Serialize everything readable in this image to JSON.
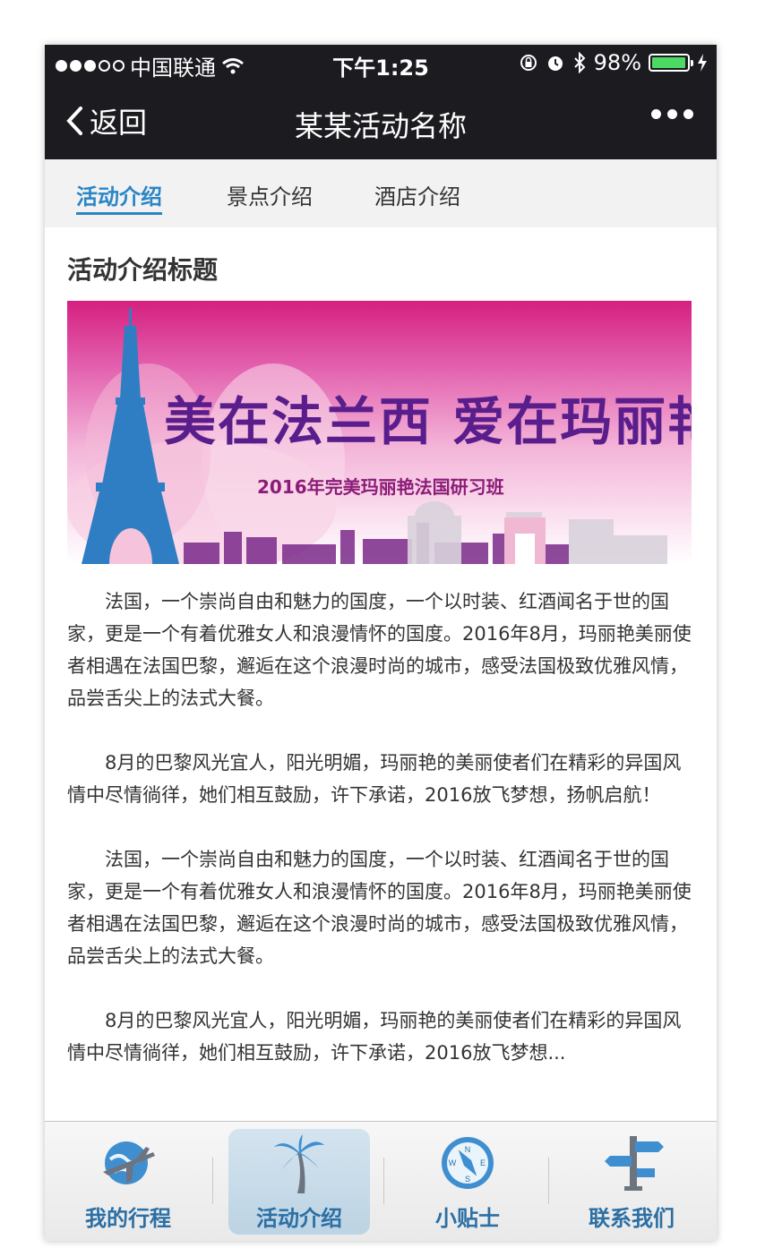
{
  "status_bar": {
    "carrier": "中国联通",
    "time": "下午1:25",
    "battery": "98%",
    "battery_level": 0.98
  },
  "nav": {
    "back_label": "返回",
    "title": "某某活动名称"
  },
  "sub_tabs": [
    {
      "label": "活动介绍",
      "active": true
    },
    {
      "label": "景点介绍",
      "active": false
    },
    {
      "label": "酒店介绍",
      "active": false
    }
  ],
  "content": {
    "heading": "活动介绍标题",
    "banner": {
      "title": "美在法兰西 爱在玛丽艳",
      "subtitle": "2016年完美玛丽艳法国研习班"
    },
    "paragraphs": [
      "法国，一个崇尚自由和魅力的国度，一个以时装、红酒闻名于世的国家，更是一个有着优雅女人和浪漫情怀的国度。2016年8月，玛丽艳美丽使者相遇在法国巴黎，邂逅在这个浪漫时尚的城市，感受法国极致优雅风情，品尝舌尖上的法式大餐。",
      "8月的巴黎风光宜人，阳光明媚，玛丽艳的美丽使者们在精彩的异国风情中尽情徜徉，她们相互鼓励，许下承诺，2016放飞梦想，扬帆启航！",
      "法国，一个崇尚自由和魅力的国度，一个以时装、红酒闻名于世的国家，更是一个有着优雅女人和浪漫情怀的国度。2016年8月，玛丽艳美丽使者相遇在法国巴黎，邂逅在这个浪漫时尚的城市，感受法国极致优雅风情，品尝舌尖上的法式大餐。",
      "8月的巴黎风光宜人，阳光明媚，玛丽艳的美丽使者们在精彩的异国风情中尽情徜徉，她们相互鼓励，许下承诺，2016放飞梦想..."
    ]
  },
  "tab_bar": [
    {
      "label": "我的行程",
      "icon": "globe-plane-icon",
      "active": false
    },
    {
      "label": "活动介绍",
      "icon": "palm-tree-icon",
      "active": true
    },
    {
      "label": "小贴士",
      "icon": "compass-icon",
      "active": false
    },
    {
      "label": "联系我们",
      "icon": "signpost-icon",
      "active": false
    }
  ],
  "colors": {
    "accent": "#2a86c6",
    "nav_bg": "#1c1b20",
    "tab_label": "#2b6fa4"
  }
}
